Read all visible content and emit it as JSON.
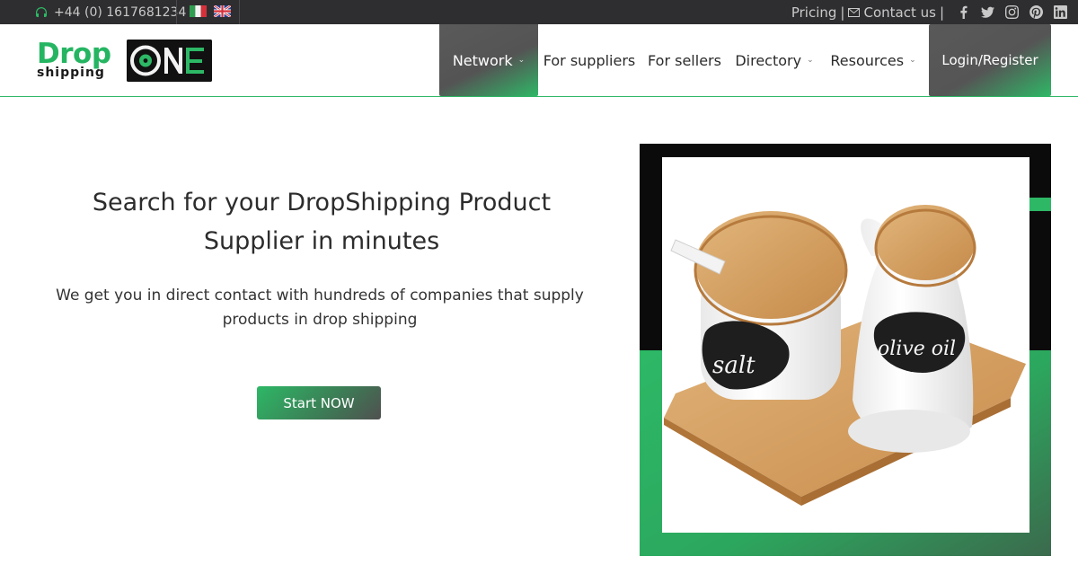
{
  "topbar": {
    "phone": "+44 (0) 1617681234",
    "phone_icon": "headset-icon",
    "flags": [
      "italy-flag-icon",
      "uk-flag-icon"
    ],
    "pricing": "Pricing",
    "divider": "|",
    "contact": "Contact us",
    "contact_icon": "envelope-icon",
    "social": [
      "facebook-icon",
      "twitter-icon",
      "instagram-icon",
      "pinterest-icon",
      "linkedin-icon"
    ]
  },
  "logo": {
    "drop": "Drop",
    "shipping": "shipping",
    "one": "ONE"
  },
  "nav": {
    "network": "Network",
    "suppliers": "For suppliers",
    "sellers": "For sellers",
    "directory": "Directory",
    "resources": "Resources",
    "login": "Login/Register",
    "chevron": "⌄"
  },
  "hero": {
    "title_line1": "Search for your DropShipping Product",
    "title_line2": "Supplier in minutes",
    "sub_line1": "We get you in direct contact with hundreds of companies that supply",
    "sub_line2": "products in drop shipping",
    "cta": "Start NOW"
  },
  "product_image": {
    "label_left": "salt",
    "label_right": "olive oil"
  },
  "colors": {
    "brand_green": "#2db866",
    "dark": "#2e2e30",
    "nav_active": "#555555"
  }
}
